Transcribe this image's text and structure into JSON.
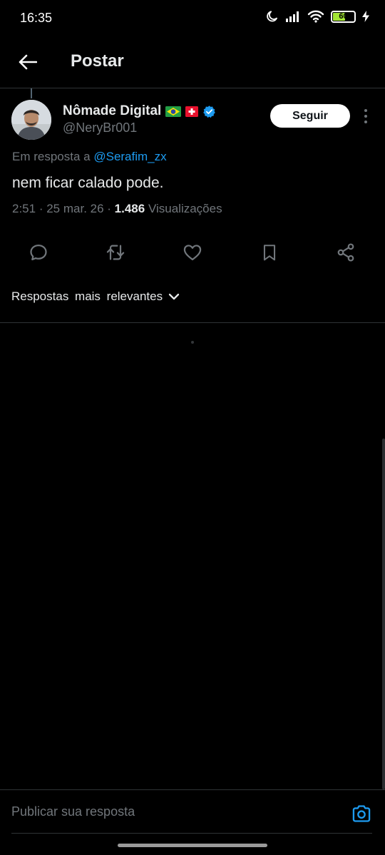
{
  "status_bar": {
    "time": "16:35",
    "battery_level": "60",
    "icons": [
      "moon-icon",
      "signal-icon",
      "wifi-icon",
      "battery-icon",
      "charging-icon"
    ],
    "battery_color": "#a3e635"
  },
  "header": {
    "title": "Postar",
    "back_icon": "arrow-left-icon"
  },
  "post": {
    "author_name": "Nômade Digital",
    "author_flags": [
      "🇧🇷",
      "🇨🇭"
    ],
    "verified": true,
    "author_handle": "@NeryBr001",
    "follow_label": "Seguir",
    "reply_prefix": "Em resposta a",
    "reply_mention": "@Serafim_zx",
    "text": "nem ficar calado pode.",
    "time": "2:51",
    "date": "25 mar. 26",
    "views_count": "1.486",
    "views_label": "Visualizações"
  },
  "actions": [
    "reply-icon",
    "repost-icon",
    "like-icon",
    "bookmark-icon",
    "share-icon"
  ],
  "replies_sort": {
    "label": "Respostas mais relevantes"
  },
  "composer": {
    "placeholder": "Publicar sua resposta"
  },
  "colors": {
    "background": "#000000",
    "text_primary": "#e7e9ea",
    "text_secondary": "#71767b",
    "accent": "#1d9bf0",
    "divider": "#2f3336"
  }
}
